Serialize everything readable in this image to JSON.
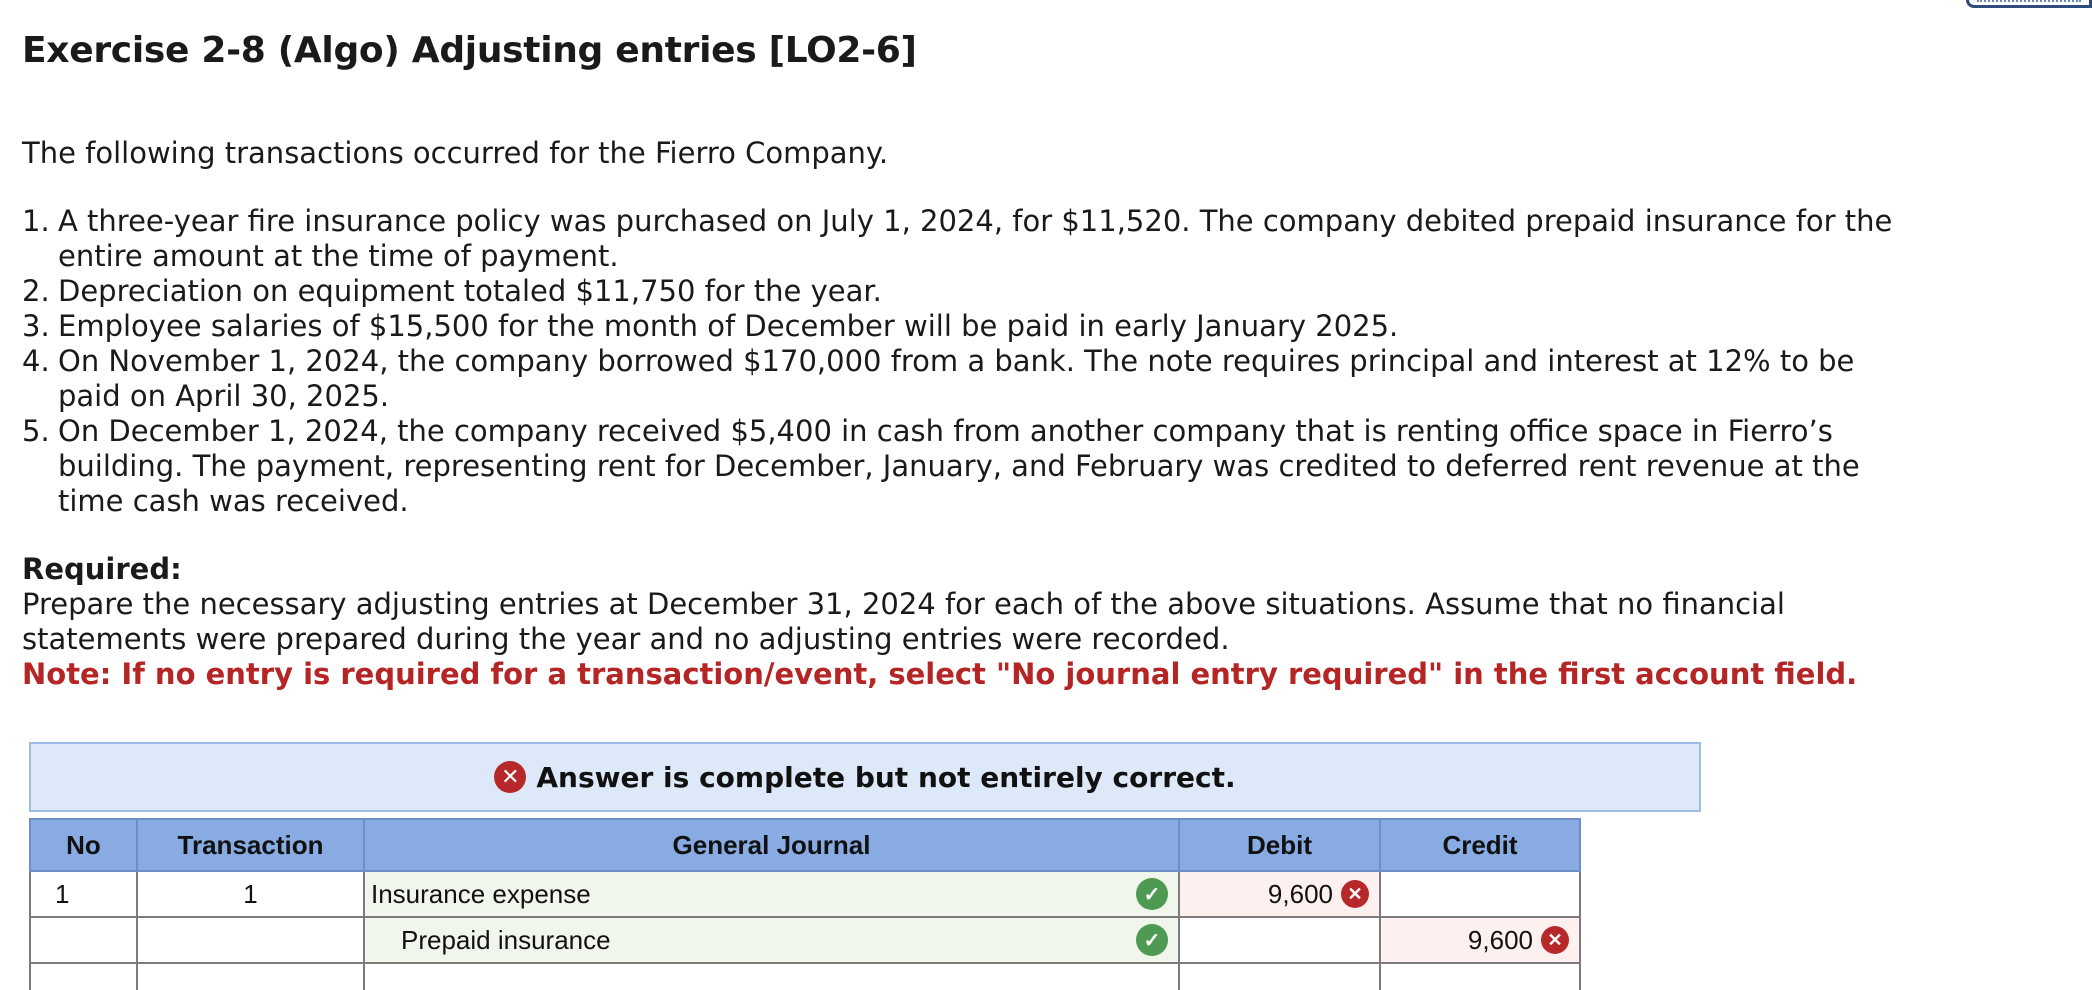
{
  "title": "Exercise 2-8 (Algo) Adjusting entries [LO2-6]",
  "intro": "The following transactions occurred for the Fierro Company.",
  "transactions": [
    {
      "num": "1.",
      "text": "A three-year fire insurance policy was purchased on July 1, 2024, for $11,520. The company debited prepaid insurance for the entire amount at the time of payment."
    },
    {
      "num": "2.",
      "text": "Depreciation on equipment totaled $11,750 for the year."
    },
    {
      "num": "3.",
      "text": "Employee salaries of $15,500 for the month of December will be paid in early January 2025."
    },
    {
      "num": "4.",
      "text": "On November 1, 2024, the company borrowed $170,000 from a bank. The note requires principal and interest at 12% to be paid on April 30, 2025."
    },
    {
      "num": "5.",
      "text": "On December 1, 2024, the company received $5,400 in cash from another company that is renting office space in Fierro’s building. The payment, representing rent for December, January, and February was credited to deferred rent revenue at the time cash was received."
    }
  ],
  "required": {
    "heading": "Required:",
    "text": "Prepare the necessary adjusting entries at December 31, 2024 for each of the above situations. Assume that no financial statements were prepared during the year and no adjusting entries were recorded.",
    "note": "Note: If no entry is required for a transaction/event, select \"No journal entry required\" in the first account field."
  },
  "banner": {
    "icon": "x-circle-icon",
    "text": "Answer is complete but not entirely correct."
  },
  "journal": {
    "headers": {
      "no": "No",
      "transaction": "Transaction",
      "general_journal": "General Journal",
      "debit": "Debit",
      "credit": "Credit"
    },
    "rows": [
      {
        "no": "1",
        "transaction": "1",
        "account": "Insurance expense",
        "debit": "9,600",
        "credit": ""
      },
      {
        "no": "",
        "transaction": "",
        "account": "Prepaid insurance",
        "debit": "",
        "credit": "9,600"
      }
    ]
  },
  "colors": {
    "note_red": "#b52525",
    "banner_bg": "#dde9f8",
    "header_bg": "#87abe2",
    "correct_green": "#4f9a53",
    "incorrect_red": "#b7282b"
  }
}
